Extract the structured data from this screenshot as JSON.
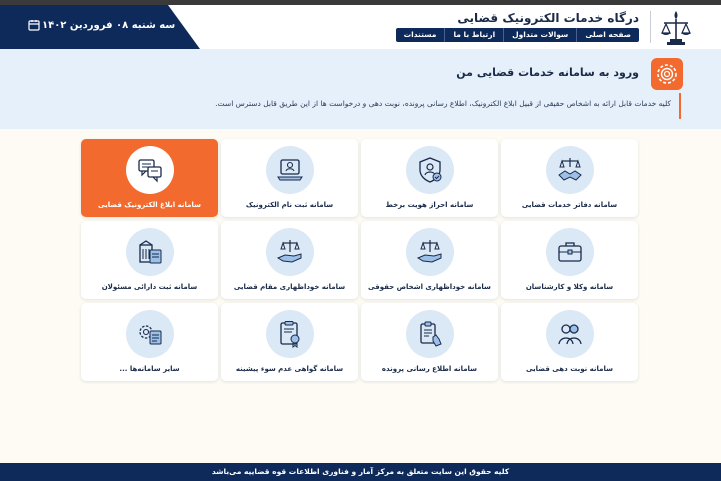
{
  "header": {
    "title": "درگاه خدمات الکترونیک قضایی",
    "date": "سه شنبه ۰۸ فروردین ۱۴۰۲",
    "nav": [
      {
        "label": "صفحه اصلی"
      },
      {
        "label": "سوالات متداول"
      },
      {
        "label": "ارتباط با ما"
      },
      {
        "label": "مستندات"
      }
    ]
  },
  "banner": {
    "title": "ورود به سامانه خدمات قضایی من",
    "description": "کلیه خدمات قابل ارائه به اشخاص حقیقی از قبیل ابلاغ الکترونیک، اطلاع رسانی پرونده، نوبت دهی و درخواست ها از این طریق قابل دسترس است."
  },
  "services": [
    {
      "label": "سامانه دفاتر خدمات قضایی",
      "icon": "handshake-scales-icon"
    },
    {
      "label": "سامانه احراز هویت برخط",
      "icon": "shield-user-icon"
    },
    {
      "label": "سامانه ثبت نام الکترونیک",
      "icon": "laptop-user-icon"
    },
    {
      "label": "سامانه ابلاغ الکترونیک قضایی",
      "icon": "chat-bubbles-icon",
      "active": true
    },
    {
      "label": "سامانه وکلا و کارشناسان",
      "icon": "briefcase-icon"
    },
    {
      "label": "سامانه خوداظهاری اشخاص حقوقی",
      "icon": "hand-scales-icon"
    },
    {
      "label": "سامانه خوداظهاری مقام قضایی",
      "icon": "hand-scales-icon"
    },
    {
      "label": "سامانه ثبت دارائی مسئولان",
      "icon": "building-document-icon"
    },
    {
      "label": "سامانه نوبت دهی قضایی",
      "icon": "users-icon"
    },
    {
      "label": "سامانه اطلاع رسانی پرونده",
      "icon": "clipboard-hand-icon"
    },
    {
      "label": "سامانه گواهی عدم سوء پیشینه",
      "icon": "certificate-icon"
    },
    {
      "label": "سایر سامانه‌ها ...",
      "icon": "gear-document-icon"
    }
  ],
  "footer": {
    "text": "کلیه حقوق این سایت متعلق به مرکز آمار و فناوری اطلاعات قوه قضاییه می‌باشد"
  },
  "colors": {
    "navy": "#0e2a5a",
    "accent": "#f26a2e",
    "banner_bg": "#e6f0fa",
    "icon_circle": "#dbe8f6"
  }
}
